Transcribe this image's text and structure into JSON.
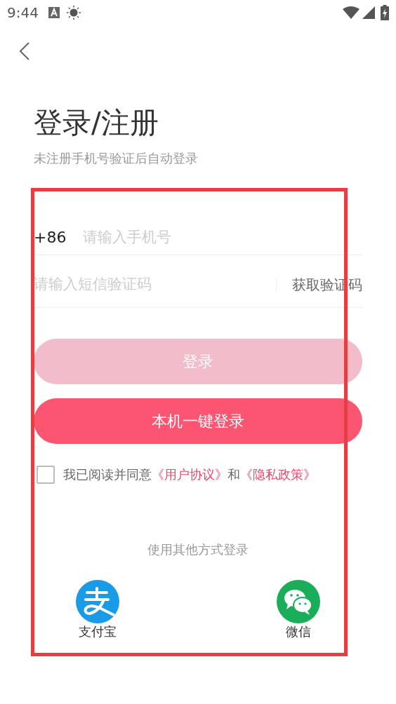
{
  "status_bar": {
    "time": "9:44"
  },
  "title": "登录/注册",
  "subtitle": "未注册手机号验证后自动登录",
  "phone": {
    "prefix": "+86",
    "placeholder": "请输入手机号"
  },
  "sms": {
    "placeholder": "请输入短信验证码",
    "button": "获取验证码"
  },
  "login_button": {
    "label": "登录",
    "disabled": true
  },
  "quick_login_button": {
    "label": "本机一键登录"
  },
  "agreement": {
    "checked": false,
    "text": "我已阅读并同意",
    "link_1": "《用户协议》",
    "joiner": "和",
    "link_2": "《隐私政策》"
  },
  "other_login": "使用其他方式登录",
  "providers": [
    {
      "kind": "alipay",
      "label": "支付宝"
    },
    {
      "kind": "wechat",
      "label": "微信"
    }
  ]
}
